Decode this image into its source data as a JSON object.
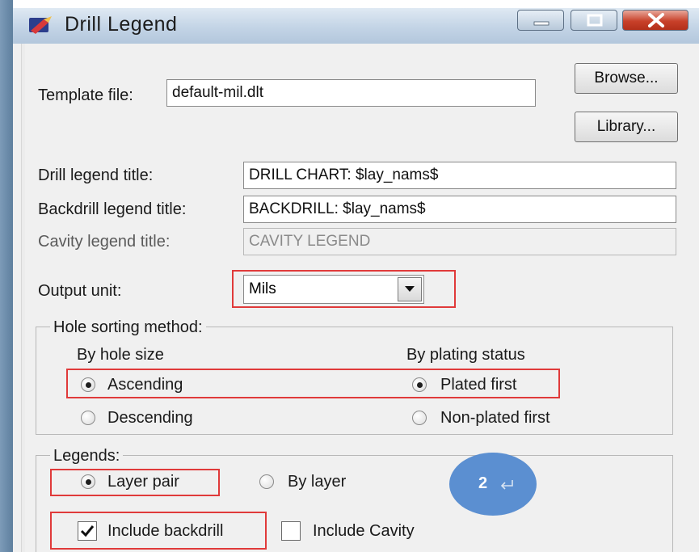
{
  "window": {
    "title": "Drill Legend"
  },
  "template": {
    "label": "Template file:",
    "value": "default-mil.dlt"
  },
  "buttons": {
    "browse": "Browse...",
    "library": "Library..."
  },
  "titles": {
    "drill_label": "Drill legend title:",
    "drill_value": "DRILL CHART: $lay_nams$",
    "backdrill_label": "Backdrill legend title:",
    "backdrill_value": "BACKDRILL: $lay_nams$",
    "cavity_label": "Cavity legend title:",
    "cavity_value": "CAVITY LEGEND"
  },
  "output_unit": {
    "label": "Output unit:",
    "selected": "Mils"
  },
  "hole_sorting": {
    "title": "Hole sorting method:",
    "by_size": {
      "heading": "By hole size",
      "options": [
        "Ascending",
        "Descending"
      ],
      "selected": "Ascending"
    },
    "by_plating": {
      "heading": "By plating status",
      "options": [
        "Plated first",
        "Non-plated first"
      ],
      "selected": "Plated first"
    }
  },
  "legends": {
    "title": "Legends:",
    "options": [
      "Layer pair",
      "By layer"
    ],
    "selected": "Layer pair",
    "include_backdrill": {
      "label": "Include backdrill",
      "checked": true
    },
    "include_cavity": {
      "label": "Include Cavity",
      "checked": false
    }
  },
  "annotation": {
    "badge": "2"
  },
  "colors": {
    "highlight": "#e03a3a",
    "badge": "#5b8fd1",
    "close_button": "#c8412a"
  }
}
